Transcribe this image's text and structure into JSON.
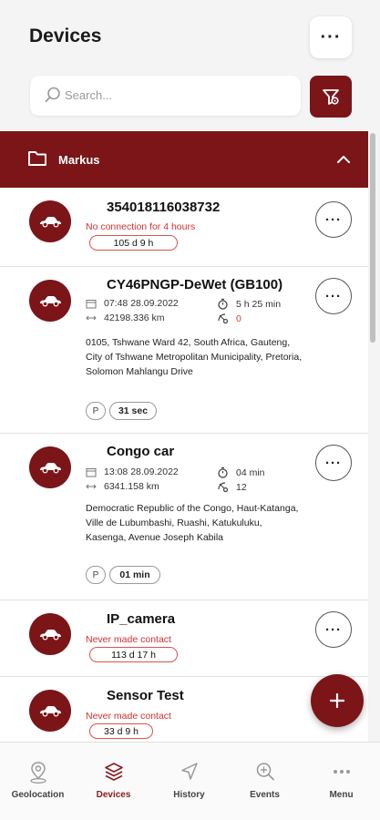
{
  "header": {
    "title": "Devices",
    "more_icon": "ellipsis-icon"
  },
  "search": {
    "placeholder": "Search..."
  },
  "filter": {
    "icon": "filter-settings-icon"
  },
  "group": {
    "name": "Markus",
    "expanded": true
  },
  "colors": {
    "brand": "#7b1518",
    "error": "#d1302f",
    "status_alert": "#e0392b"
  },
  "devices": [
    {
      "name": "354018116038732",
      "status": "No connection for 4 hours",
      "duration": "105 d 9 h"
    },
    {
      "name": "CY46PNGP-DeWet (GB100)",
      "time": "07:48 28.09.2022",
      "distance": "42198.336 km",
      "duration": "5 h 25 min",
      "satellites": "0",
      "address": "0105, Tshwane Ward 42, South Africa, Gauteng, City of Tshwane Metropolitan Municipality, Pretoria, Solomon Mahlangu Drive",
      "state": "P",
      "state_duration": "31 sec"
    },
    {
      "name": "Congo car",
      "time": "13:08 28.09.2022",
      "distance": "6341.158 km",
      "duration": "04 min",
      "satellites": "12",
      "address": "Democratic Republic of the Congo, Haut-Katanga, Ville de Lubumbashi, Ruashi, Katukuluku, Kasenga, Avenue Joseph Kabila",
      "state": "P",
      "state_duration": "01 min"
    },
    {
      "name": "IP_camera",
      "status": "Never made contact",
      "duration": "113 d 17 h"
    },
    {
      "name": "Sensor Test",
      "status": "Never made contact",
      "duration": "33 d 9 h"
    }
  ],
  "nav": [
    {
      "label": "Geolocation",
      "icon": "map-pin-icon",
      "active": false
    },
    {
      "label": "Devices",
      "icon": "layers-icon",
      "active": true
    },
    {
      "label": "History",
      "icon": "navigation-arrow-icon",
      "active": false
    },
    {
      "label": "Events",
      "icon": "zoom-plus-icon",
      "active": false
    },
    {
      "label": "Menu",
      "icon": "ellipsis-icon",
      "active": false
    }
  ]
}
